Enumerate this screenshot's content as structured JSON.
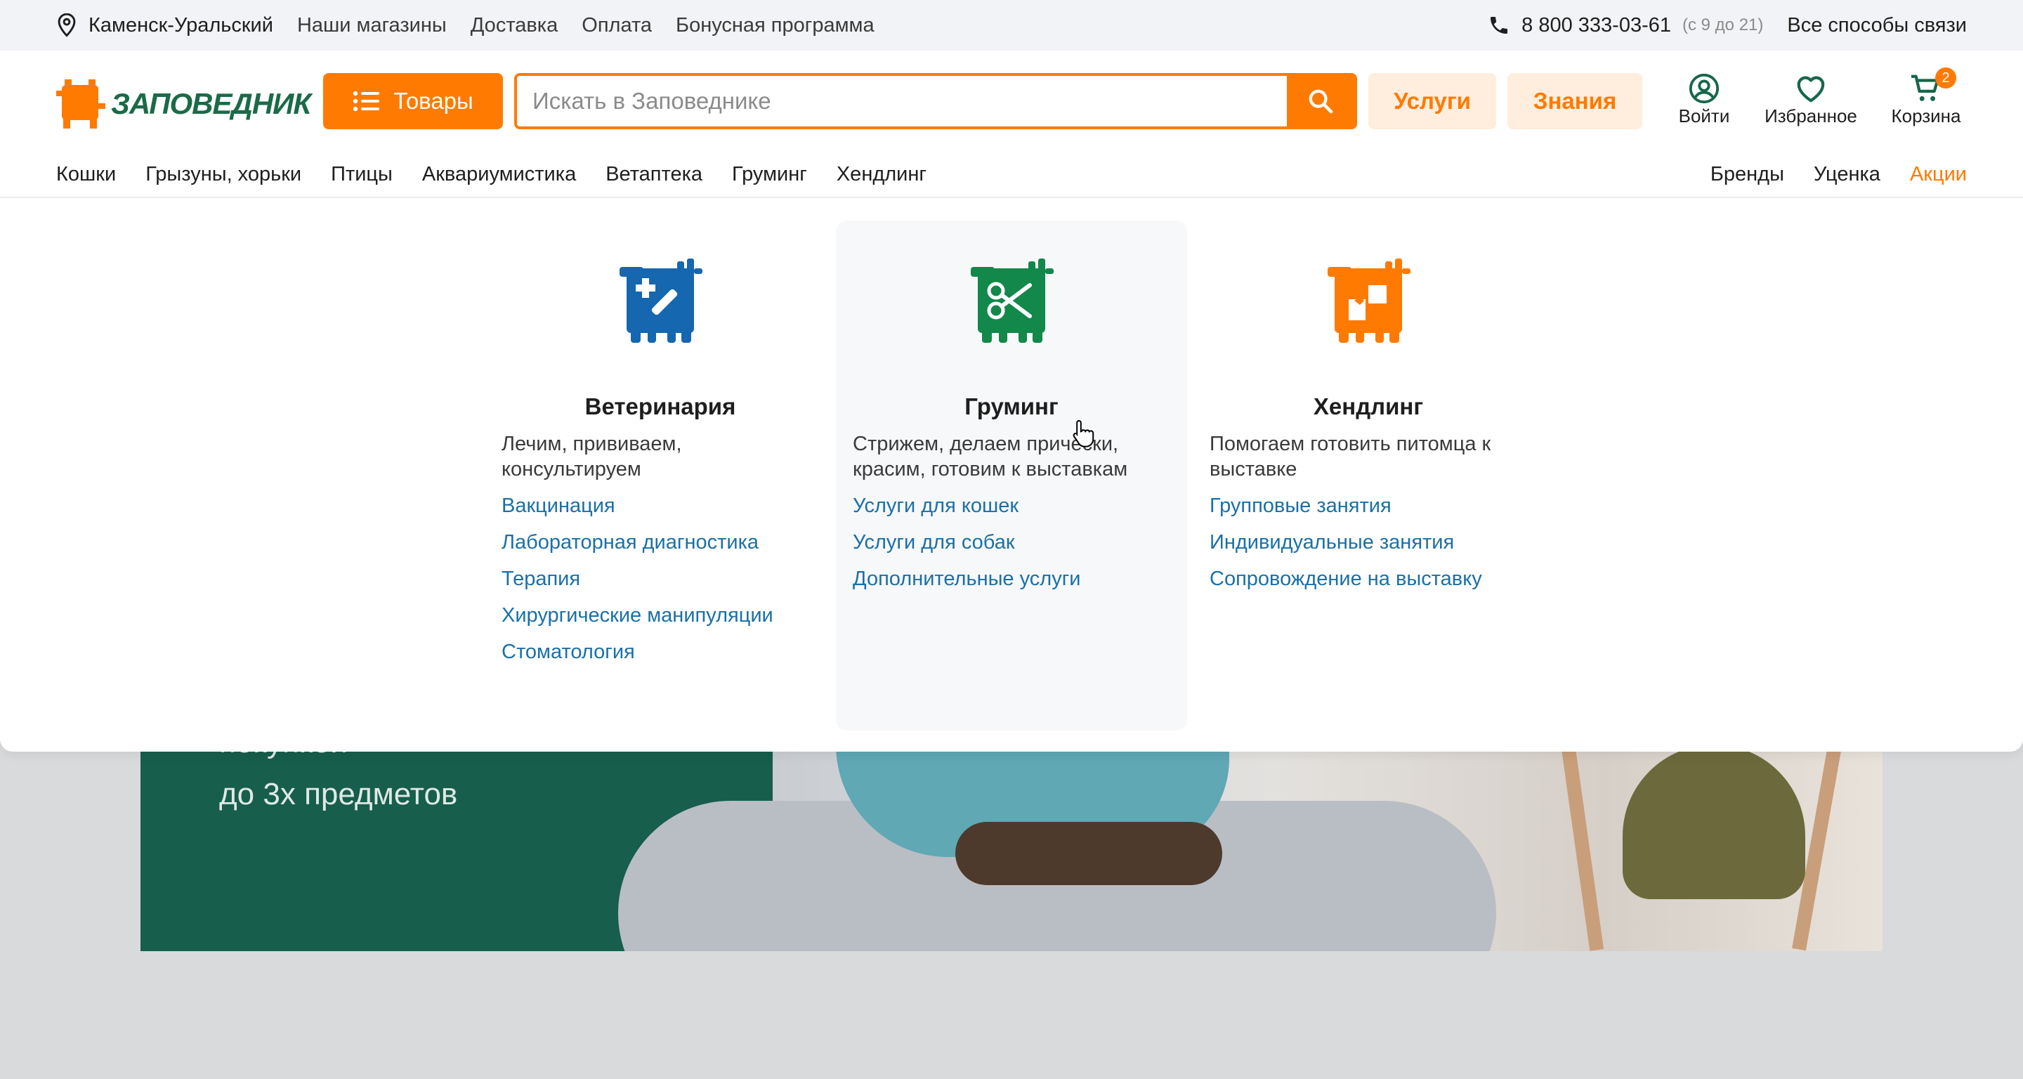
{
  "topbar": {
    "city": "Каменск-Уральский",
    "links": [
      "Наши магазины",
      "Доставка",
      "Оплата",
      "Бонусная программа"
    ],
    "phone": "8 800 333-03-61",
    "hours": "(с 9 до 21)",
    "contacts": "Все способы связи"
  },
  "header": {
    "logo_text": "ЗАПОВЕДНИК",
    "catalog_label": "Товары",
    "search_placeholder": "Искать в Заповеднике",
    "services_label": "Услуги",
    "knowledge_label": "Знания",
    "login_label": "Войти",
    "favorites_label": "Избранное",
    "cart_label": "Корзина",
    "cart_count": "2"
  },
  "catnav": {
    "left": [
      "Кошки",
      "Грызуны, хорьки",
      "Птицы",
      "Аквариумистика",
      "Ветаптека",
      "Груминг",
      "Хендлинг"
    ],
    "right": [
      "Бренды",
      "Уценка",
      "Акции"
    ]
  },
  "dropdown": {
    "columns": [
      {
        "title": "Ветеринария",
        "description": "Лечим, прививаем, консультируем",
        "color": "#1567b0",
        "links": [
          "Вакцинация",
          "Лабораторная диагностика",
          "Терапия",
          "Хирургические манипуляции",
          "Стоматология"
        ]
      },
      {
        "title": "Груминг",
        "description": "Стрижем, делаем прически, красим, готовим к выставкам",
        "color": "#12884a",
        "links": [
          "Услуги для кошек",
          "Услуги для собак",
          "Дополнительные услуги"
        ]
      },
      {
        "title": "Хендлинг",
        "description": "Помогаем готовить питомца к выставке",
        "color": "#ff7a00",
        "links": [
          "Групповые занятия",
          "Индивидуальные занятия",
          "Сопровождение на выставку"
        ]
      }
    ]
  },
  "banner": {
    "line1": "покупкой",
    "line2": "до 3х предметов"
  },
  "colors": {
    "accent": "#ff7a00",
    "brand_green": "#1b6a48",
    "link_blue": "#1a70a8"
  },
  "icons": [
    "location-pin-icon",
    "phone-icon",
    "list-icon",
    "search-icon",
    "user-icon",
    "heart-icon",
    "cart-icon",
    "vet-emblem-icon",
    "grooming-emblem-icon",
    "handling-emblem-icon",
    "hand-cursor-icon"
  ]
}
